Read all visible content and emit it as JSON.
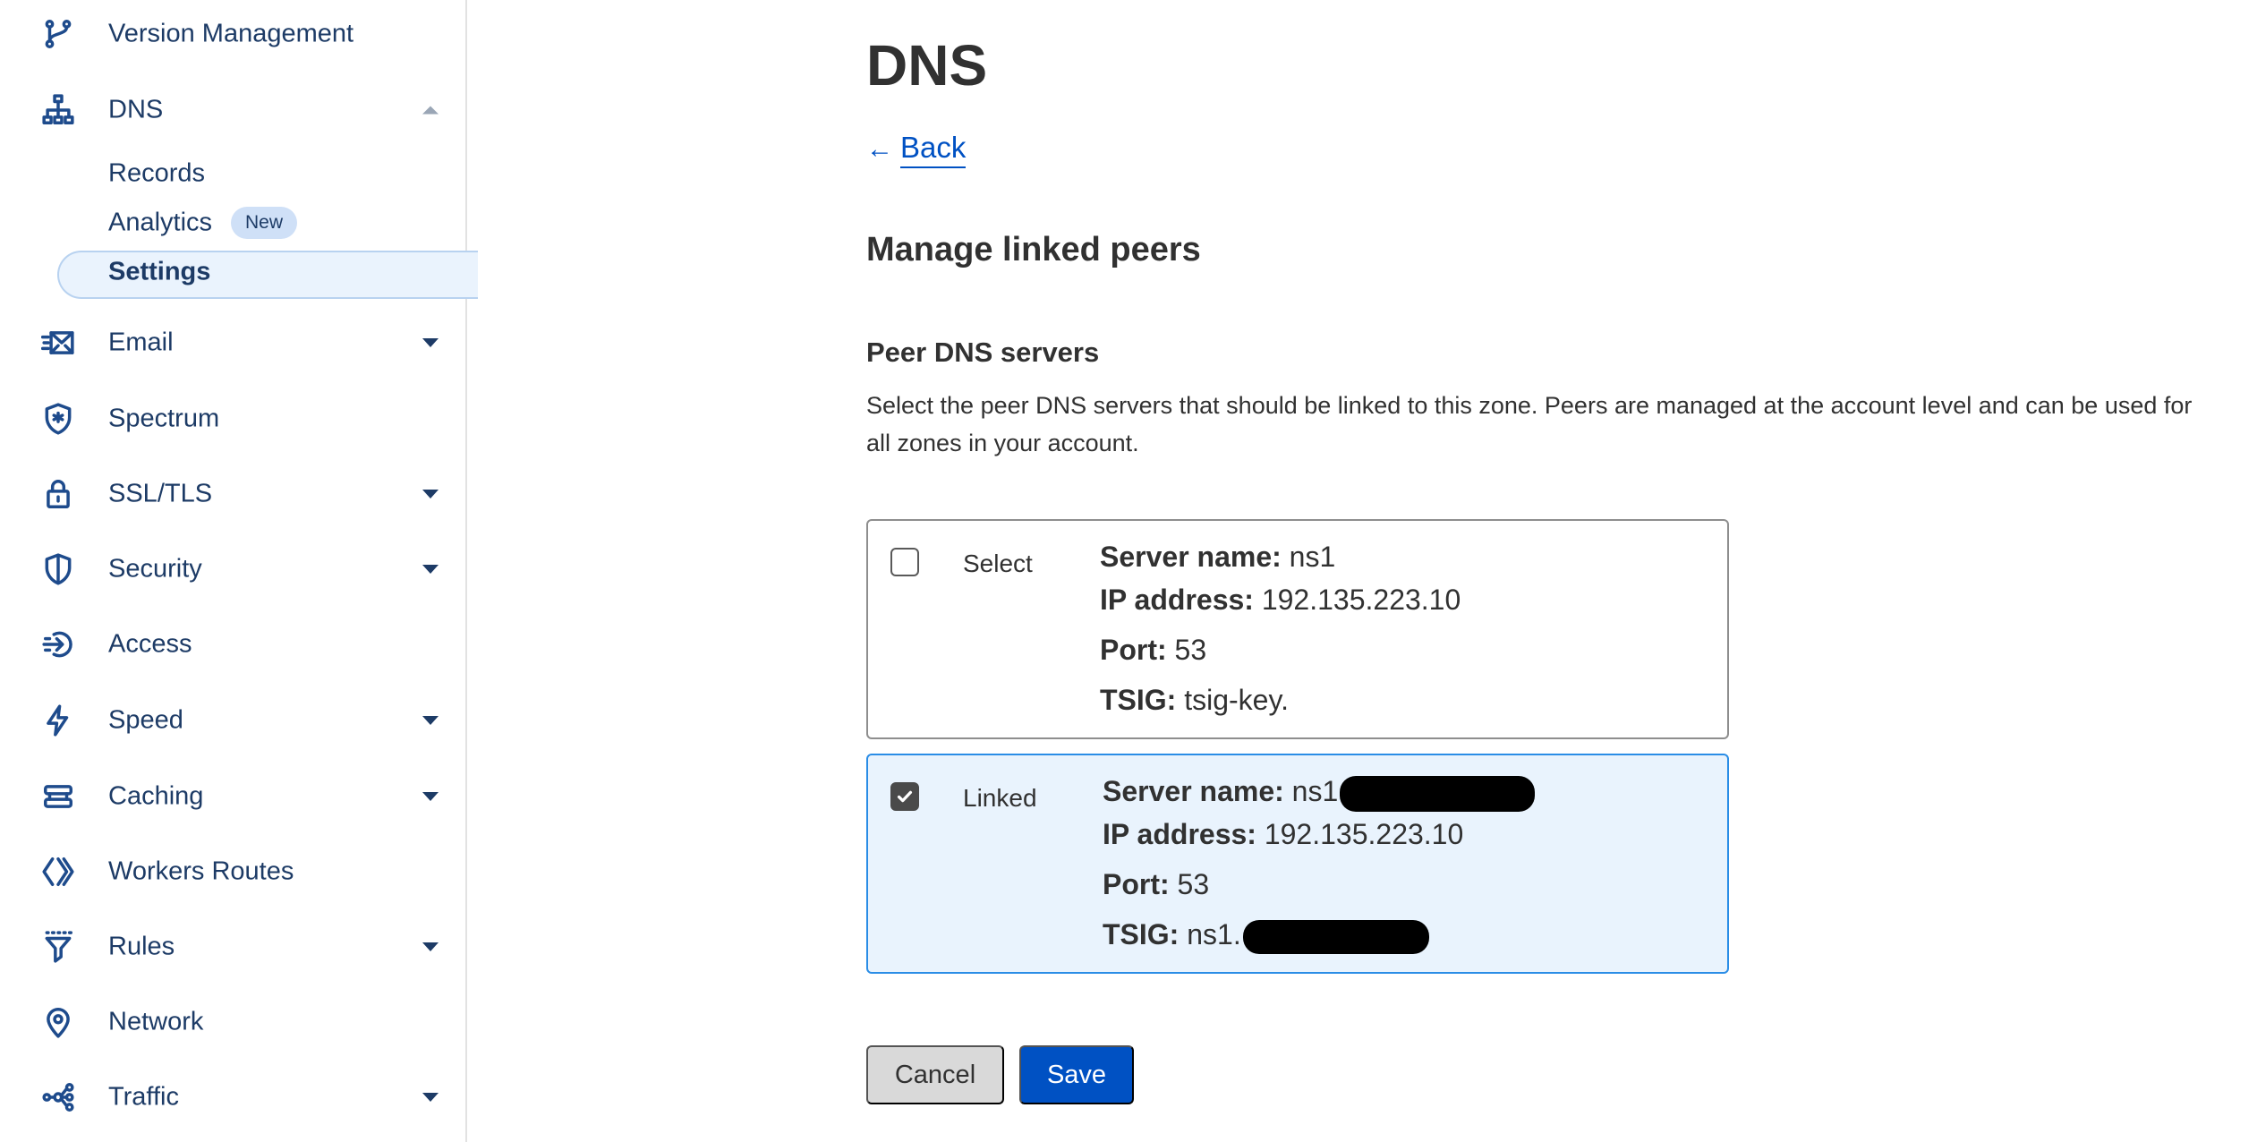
{
  "sidebar": {
    "version_management": "Version Management",
    "dns": "DNS",
    "dns_sub": {
      "records": "Records",
      "analytics": "Analytics",
      "analytics_badge": "New",
      "settings": "Settings"
    },
    "email": "Email",
    "spectrum": "Spectrum",
    "ssl_tls": "SSL/TLS",
    "security": "Security",
    "access": "Access",
    "speed": "Speed",
    "caching": "Caching",
    "workers_routes": "Workers Routes",
    "rules": "Rules",
    "network": "Network",
    "traffic": "Traffic"
  },
  "main": {
    "title": "DNS",
    "back_arrow": "←",
    "back_label": "Back",
    "section_title": "Manage linked peers",
    "peer_title": "Peer DNS servers",
    "peer_description": "Select the peer DNS servers that should be linked to this zone. Peers are managed at the account level and can be used for all zones in your account."
  },
  "peers": [
    {
      "state_label": "Select",
      "checked": false,
      "server_name_label": "Server name:",
      "server_name": "ns1",
      "ip_label": "IP address:",
      "ip": "192.135.223.10",
      "port_label": "Port:",
      "port": "53",
      "tsig_label": "TSIG:",
      "tsig": "tsig-key."
    },
    {
      "state_label": "Linked",
      "checked": true,
      "server_name_label": "Server name:",
      "server_name": "ns1",
      "ip_label": "IP address:",
      "ip": "192.135.223.10",
      "port_label": "Port:",
      "port": "53",
      "tsig_label": "TSIG:",
      "tsig": "ns1."
    }
  ],
  "buttons": {
    "cancel": "Cancel",
    "save": "Save"
  },
  "colors": {
    "accent": "#0051c3",
    "sidebar_text": "#1d3b66",
    "linked_bg": "#e9f3fd",
    "linked_border": "#2a8de6"
  }
}
